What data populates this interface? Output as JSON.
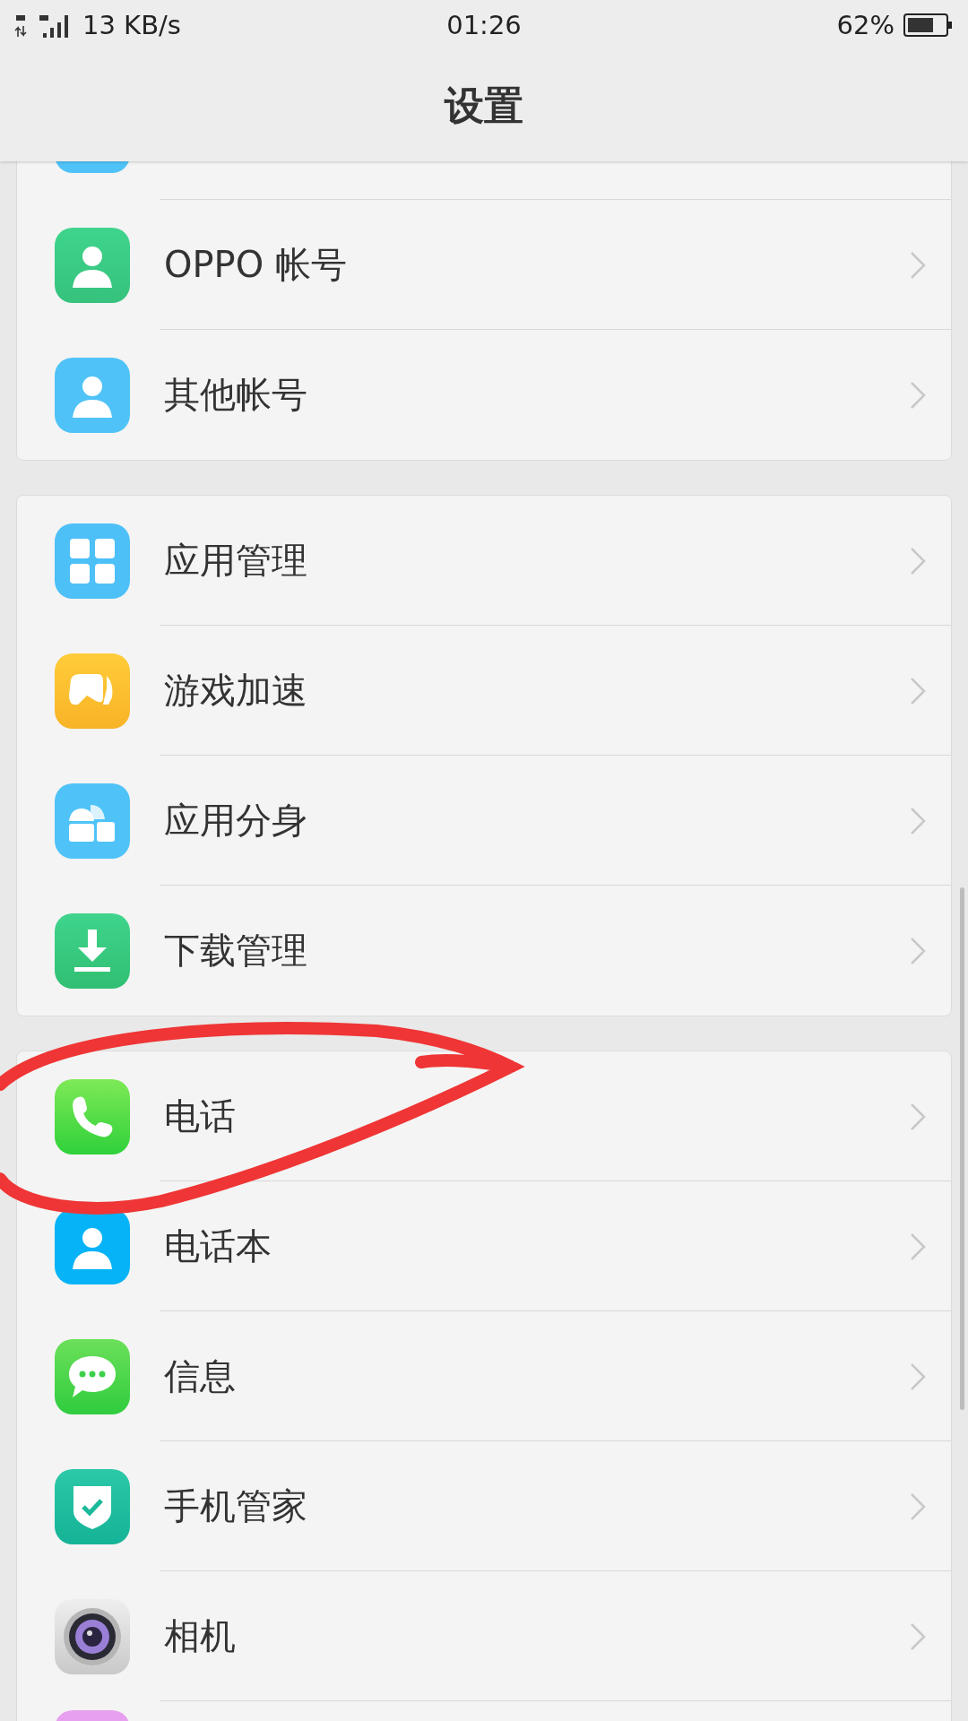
{
  "status_bar": {
    "network": "13 KB/s",
    "time": "01:26",
    "battery": "62%"
  },
  "header": {
    "title": "设置"
  },
  "groups": [
    {
      "items": [
        {
          "kind": "cut-blue"
        },
        {
          "kind": "account",
          "label": "OPPO 帐号"
        },
        {
          "kind": "other-account",
          "label": "其他帐号"
        }
      ]
    },
    {
      "items": [
        {
          "kind": "apps",
          "label": "应用管理"
        },
        {
          "kind": "game",
          "label": "游戏加速"
        },
        {
          "kind": "clone",
          "label": "应用分身"
        },
        {
          "kind": "download",
          "label": "下载管理"
        }
      ]
    },
    {
      "items": [
        {
          "kind": "phone",
          "label": "电话"
        },
        {
          "kind": "contacts",
          "label": "电话本"
        },
        {
          "kind": "messages",
          "label": "信息"
        },
        {
          "kind": "security",
          "label": "手机管家"
        },
        {
          "kind": "camera",
          "label": "相机"
        },
        {
          "kind": "cut-pink"
        }
      ]
    }
  ]
}
